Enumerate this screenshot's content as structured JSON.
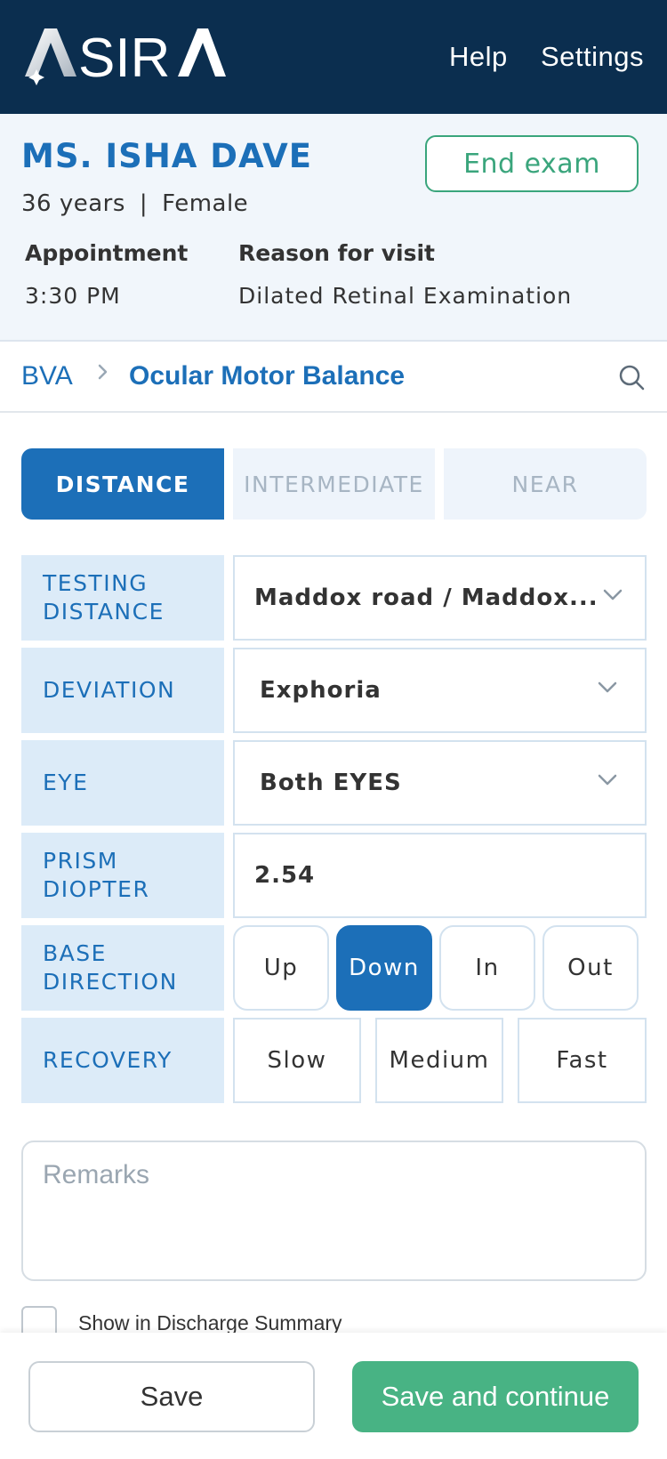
{
  "header": {
    "logo_text": "ASIRA",
    "nav": {
      "help": "Help",
      "settings": "Settings"
    },
    "colors": {
      "background": "#0b2e4f"
    }
  },
  "patient": {
    "name": "MS. ISHA DAVE",
    "age": "36 years",
    "separator": "|",
    "gender": "Female",
    "end_exam_label": "End exam",
    "appointment_label": "Appointment",
    "appointment_value": "3:30 PM",
    "reason_label": "Reason for visit",
    "reason_value": "Dilated Retinal Examination"
  },
  "breadcrumb": {
    "parent": "BVA",
    "separator_icon": "chevron-right-icon",
    "current": "Ocular Motor Balance",
    "search_icon": "search-icon"
  },
  "tabs": [
    {
      "label": "DISTANCE",
      "active": true
    },
    {
      "label": "INTERMEDIATE",
      "active": false
    },
    {
      "label": "NEAR",
      "active": false
    }
  ],
  "form": {
    "testing_distance": {
      "label_line1": "TESTING",
      "label_line2": "DISTANCE",
      "value": "Maddox road / Maddox..."
    },
    "deviation": {
      "label": "DEVIATION",
      "value": "Exphoria"
    },
    "eye": {
      "label": "EYE",
      "value": "Both EYES"
    },
    "prism_diopter": {
      "label_line1": "PRISM",
      "label_line2": "DIOPTER",
      "value": "2.54"
    },
    "base_direction": {
      "label_line1": "BASE",
      "label_line2": "DIRECTION",
      "options": [
        "Up",
        "Down",
        "In",
        "Out"
      ],
      "selected": "Down"
    },
    "recovery": {
      "label": "RECOVERY",
      "options": [
        "Slow",
        "Medium",
        "Fast"
      ],
      "selected": null
    },
    "remarks_placeholder": "Remarks",
    "discharge_checkbox_label": "Show in Discharge Summary",
    "discharge_checked": false
  },
  "footer": {
    "save_label": "Save",
    "save_continue_label": "Save and continue"
  },
  "colors": {
    "accent": "#1c6fb8",
    "success": "#48b384",
    "end_exam": "#3aa57c"
  }
}
